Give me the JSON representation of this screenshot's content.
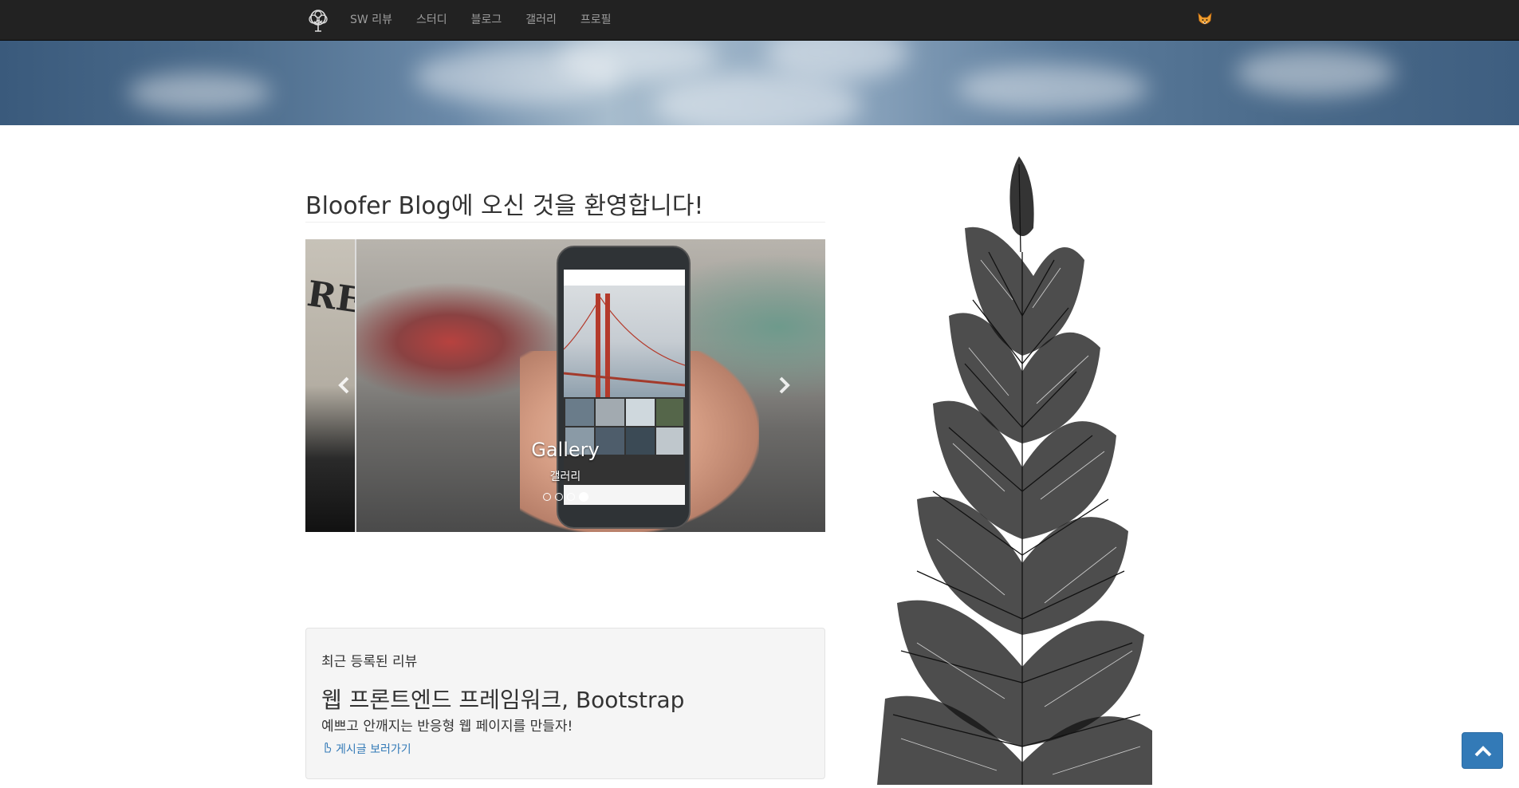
{
  "navbar": {
    "brand_icon": "tree-logo-icon",
    "items": [
      {
        "label": "SW 리뷰"
      },
      {
        "label": "스터디"
      },
      {
        "label": "블로그"
      },
      {
        "label": "갤러리"
      },
      {
        "label": "프로필"
      }
    ],
    "user_icon": "fox-avatar-icon"
  },
  "main": {
    "title": "Bloofer Blog에 오신 것을 환영합니다!"
  },
  "carousel": {
    "prev_slide_text": "REE",
    "caption_title": "Gallery",
    "caption_subtitle": "갤러리",
    "indicator_count": 4,
    "active_index": 3,
    "prev_icon": "chevron-left-icon",
    "next_icon": "chevron-right-icon"
  },
  "review": {
    "label": "최근 등록된 리뷰",
    "title": "웹 프론트엔드 프레임워크, Bootstrap",
    "description": "예쁘고 안깨지는 반응형 웹 페이지를 만들자!",
    "link_text": "게시글 보러가기",
    "link_icon": "hand-pointer-icon"
  },
  "back_to_top": {
    "icon": "chevron-up-icon"
  },
  "colors": {
    "navbar_bg": "#222222",
    "nav_text": "#9d9d9d",
    "link": "#337ab7",
    "button_primary": "#337ab7",
    "well_bg": "#f5f5f5"
  }
}
